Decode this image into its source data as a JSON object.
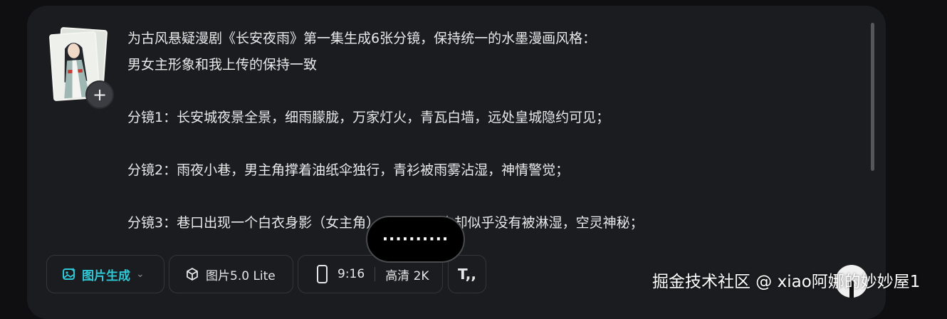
{
  "prompt": {
    "lines": [
      "为古风悬疑漫剧《长安夜雨》第一集生成6张分镜，保持统一的水墨漫画风格：",
      "男女主形象和我上传的保持一致",
      "",
      "分镜1：长安城夜景全景，细雨朦胧，万家灯火，青瓦白墙，远处皇城隐约可见；",
      "",
      "分镜2：雨夜小巷，男主角撑着油纸伞独行，青衫被雨雾沾湿，神情警觉；",
      "",
      "分镜3：巷口出现一个白衣身影（女主角），她站在雨中却似乎没有被淋湿，空灵神秘；"
    ]
  },
  "attachment": {
    "add_label": "+"
  },
  "toolbar": {
    "mode_icon": "image-sparkle-icon",
    "mode_label": "图片生成",
    "model_icon": "cube-icon",
    "model_label": "图片5.0 Lite",
    "ratio_icon": "phone-portrait-icon",
    "ratio_label": "9:16",
    "quality_label": "高清 2K",
    "text_icon": "text-format-icon",
    "text_label": "T,,"
  },
  "loading": {
    "text": "··········"
  },
  "watermark": {
    "text": "掘金技术社区 @ xiao阿娜的妙妙屋1"
  },
  "colors": {
    "accent": "#2fc8d6",
    "panel_bg": "#1b1c1f",
    "page_bg": "#0f0f11",
    "text": "#e9e9ea"
  }
}
